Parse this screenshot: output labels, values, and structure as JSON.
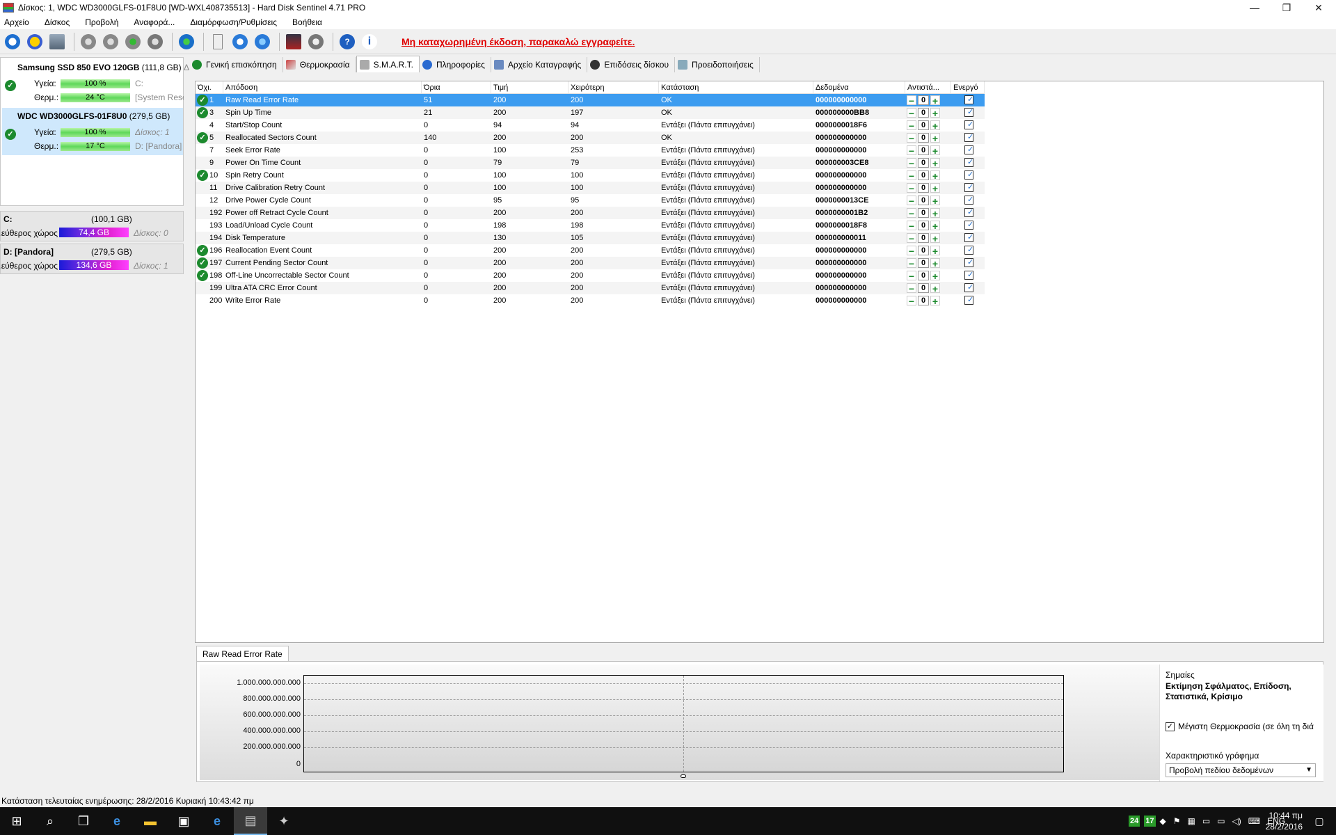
{
  "window": {
    "title": "Δίσκος: 1, WDC WD3000GLFS-01F8U0 [WD-WXL408735513]  -  Hard Disk Sentinel 4.71 PRO",
    "minimize": "—",
    "restore": "❐",
    "close": "✕"
  },
  "menu": [
    "Αρχείο",
    "Δίσκος",
    "Προβολή",
    "Αναφορά...",
    "Διαμόρφωση/Ρυθμίσεις",
    "Βοήθεια"
  ],
  "toolbar": {
    "notice": "Μη καταχωρημένη έκδοση, παρακαλώ εγγραφείτε.",
    "icons": [
      "refresh-icon",
      "alert-icon",
      "disk-info-icon",
      "disk-test-1-icon",
      "disk-test-2-icon",
      "disk-check-icon",
      "disk-tools-icon",
      "globe-icon",
      "report-icon",
      "report-send-icon",
      "network-icon",
      "console-icon",
      "speaker-icon",
      "help-icon",
      "about-icon"
    ]
  },
  "disks": [
    {
      "name": "Samsung SSD 850 EVO 120GB",
      "size": "(111,8 GB)",
      "size_tail": "Δι",
      "health_label": "Υγεία:",
      "health": "100 %",
      "health_side": "C:",
      "temp_label": "Θερμ.:",
      "temp": "24 °C",
      "temp_side": "[System Rese"
    },
    {
      "name": "WDC WD3000GLFS-01F8U0",
      "size": "(279,5 GB)",
      "health_label": "Υγεία:",
      "health": "100 %",
      "health_side": "Δίσκος: 1",
      "temp_label": "Θερμ.:",
      "temp": "17 °C",
      "temp_side": "D: [Pandora]"
    }
  ],
  "volumes": [
    {
      "name": "C:",
      "size": "(100,1 GB)",
      "free_label": "Ελεύθερος χώρος",
      "free": "74,4 GB",
      "disk": "Δίσκος: 0"
    },
    {
      "name": "D: [Pandora]",
      "size": "(279,5 GB)",
      "free_label": "Ελεύθερος χώρος",
      "free": "134,6 GB",
      "disk": "Δίσκος: 1"
    }
  ],
  "tabs": [
    "Γενική επισκόπηση",
    "Θερμοκρασία",
    "S.M.A.R.T.",
    "Πληροφορίες",
    "Αρχείο Καταγραφής",
    "Επιδόσεις δίσκου",
    "Προειδοποιήσεις"
  ],
  "table": {
    "headers": [
      "Όχι.",
      "Απόδοση",
      "Όρια",
      "Τιμή",
      "Χειρότερη",
      "Κατάσταση",
      "Δεδομένα",
      "Αντιστά...",
      "Ενεργό"
    ],
    "rows": [
      {
        "id": "1",
        "name": "Raw Read Error Rate",
        "threshold": "51",
        "value": "200",
        "worst": "200",
        "status": "OK",
        "data": "000000000000",
        "ok": true,
        "counter": "0"
      },
      {
        "id": "3",
        "name": "Spin Up Time",
        "threshold": "21",
        "value": "200",
        "worst": "197",
        "status": "OK",
        "data": "000000000BB8",
        "ok": true,
        "counter": "0"
      },
      {
        "id": "4",
        "name": "Start/Stop Count",
        "threshold": "0",
        "value": "94",
        "worst": "94",
        "status": "Εντάξει (Πάντα επιτυγχάνει)",
        "data": "0000000018F6",
        "ok": false,
        "counter": "0"
      },
      {
        "id": "5",
        "name": "Reallocated Sectors Count",
        "threshold": "140",
        "value": "200",
        "worst": "200",
        "status": "OK",
        "data": "000000000000",
        "ok": true,
        "counter": "0"
      },
      {
        "id": "7",
        "name": "Seek Error Rate",
        "threshold": "0",
        "value": "100",
        "worst": "253",
        "status": "Εντάξει (Πάντα επιτυγχάνει)",
        "data": "000000000000",
        "ok": false,
        "counter": "0"
      },
      {
        "id": "9",
        "name": "Power On Time Count",
        "threshold": "0",
        "value": "79",
        "worst": "79",
        "status": "Εντάξει (Πάντα επιτυγχάνει)",
        "data": "000000003CE8",
        "ok": false,
        "counter": "0"
      },
      {
        "id": "10",
        "name": "Spin Retry Count",
        "threshold": "0",
        "value": "100",
        "worst": "100",
        "status": "Εντάξει (Πάντα επιτυγχάνει)",
        "data": "000000000000",
        "ok": true,
        "counter": "0"
      },
      {
        "id": "11",
        "name": "Drive Calibration Retry Count",
        "threshold": "0",
        "value": "100",
        "worst": "100",
        "status": "Εντάξει (Πάντα επιτυγχάνει)",
        "data": "000000000000",
        "ok": false,
        "counter": "0"
      },
      {
        "id": "12",
        "name": "Drive Power Cycle Count",
        "threshold": "0",
        "value": "95",
        "worst": "95",
        "status": "Εντάξει (Πάντα επιτυγχάνει)",
        "data": "0000000013CE",
        "ok": false,
        "counter": "0"
      },
      {
        "id": "192",
        "name": "Power off Retract Cycle Count",
        "threshold": "0",
        "value": "200",
        "worst": "200",
        "status": "Εντάξει (Πάντα επιτυγχάνει)",
        "data": "0000000001B2",
        "ok": false,
        "counter": "0"
      },
      {
        "id": "193",
        "name": "Load/Unload Cycle Count",
        "threshold": "0",
        "value": "198",
        "worst": "198",
        "status": "Εντάξει (Πάντα επιτυγχάνει)",
        "data": "0000000018F8",
        "ok": false,
        "counter": "0"
      },
      {
        "id": "194",
        "name": "Disk Temperature",
        "threshold": "0",
        "value": "130",
        "worst": "105",
        "status": "Εντάξει (Πάντα επιτυγχάνει)",
        "data": "000000000011",
        "ok": false,
        "counter": "0"
      },
      {
        "id": "196",
        "name": "Reallocation Event Count",
        "threshold": "0",
        "value": "200",
        "worst": "200",
        "status": "Εντάξει (Πάντα επιτυγχάνει)",
        "data": "000000000000",
        "ok": true,
        "counter": "0"
      },
      {
        "id": "197",
        "name": "Current Pending Sector Count",
        "threshold": "0",
        "value": "200",
        "worst": "200",
        "status": "Εντάξει (Πάντα επιτυγχάνει)",
        "data": "000000000000",
        "ok": true,
        "counter": "0"
      },
      {
        "id": "198",
        "name": "Off-Line Uncorrectable Sector Count",
        "threshold": "0",
        "value": "200",
        "worst": "200",
        "status": "Εντάξει (Πάντα επιτυγχάνει)",
        "data": "000000000000",
        "ok": true,
        "counter": "0"
      },
      {
        "id": "199",
        "name": "Ultra ATA CRC Error Count",
        "threshold": "0",
        "value": "200",
        "worst": "200",
        "status": "Εντάξει (Πάντα επιτυγχάνει)",
        "data": "000000000000",
        "ok": false,
        "counter": "0"
      },
      {
        "id": "200",
        "name": "Write Error Rate",
        "threshold": "0",
        "value": "200",
        "worst": "200",
        "status": "Εντάξει (Πάντα επιτυγχάνει)",
        "data": "000000000000",
        "ok": false,
        "counter": "0"
      }
    ]
  },
  "chart": {
    "tab": "Raw Read Error Rate",
    "yticks": [
      "1.000.000.000.000",
      "800.000.000.000",
      "600.000.000.000",
      "400.000.000.000",
      "200.000.000.000",
      "0"
    ],
    "flags_label": "Σημαίες",
    "flags": "Εκτίμηση Σφάλματος, Επίδοση, Στατιστικά, Κρίσιμο",
    "max_temp_check": "Μέγιστη Θερμοκρασία (σε όλη τη διά",
    "chart_type_label": "Χαρακτηριστικό γράφημα",
    "chart_type_value": "Προβολή πεδίου δεδομένων"
  },
  "chart_data": {
    "type": "line",
    "title": "",
    "xlabel": "",
    "ylabel": "",
    "ylim": [
      0,
      1000000000000
    ],
    "ytick_labels": [
      "1.000.000.000.000",
      "800.000.000.000",
      "600.000.000.000",
      "400.000.000.000",
      "200.000.000.000",
      "0"
    ],
    "grid": true,
    "series": []
  },
  "status": "Κατάσταση τελευταίας ενημέρωσης: 28/2/2016 Κυριακή 10:43:42 πμ",
  "taskbar": {
    "temp1": "24",
    "temp2": "17",
    "lang": "ENG",
    "time": "10:44 πμ",
    "date": "28/2/2016"
  }
}
